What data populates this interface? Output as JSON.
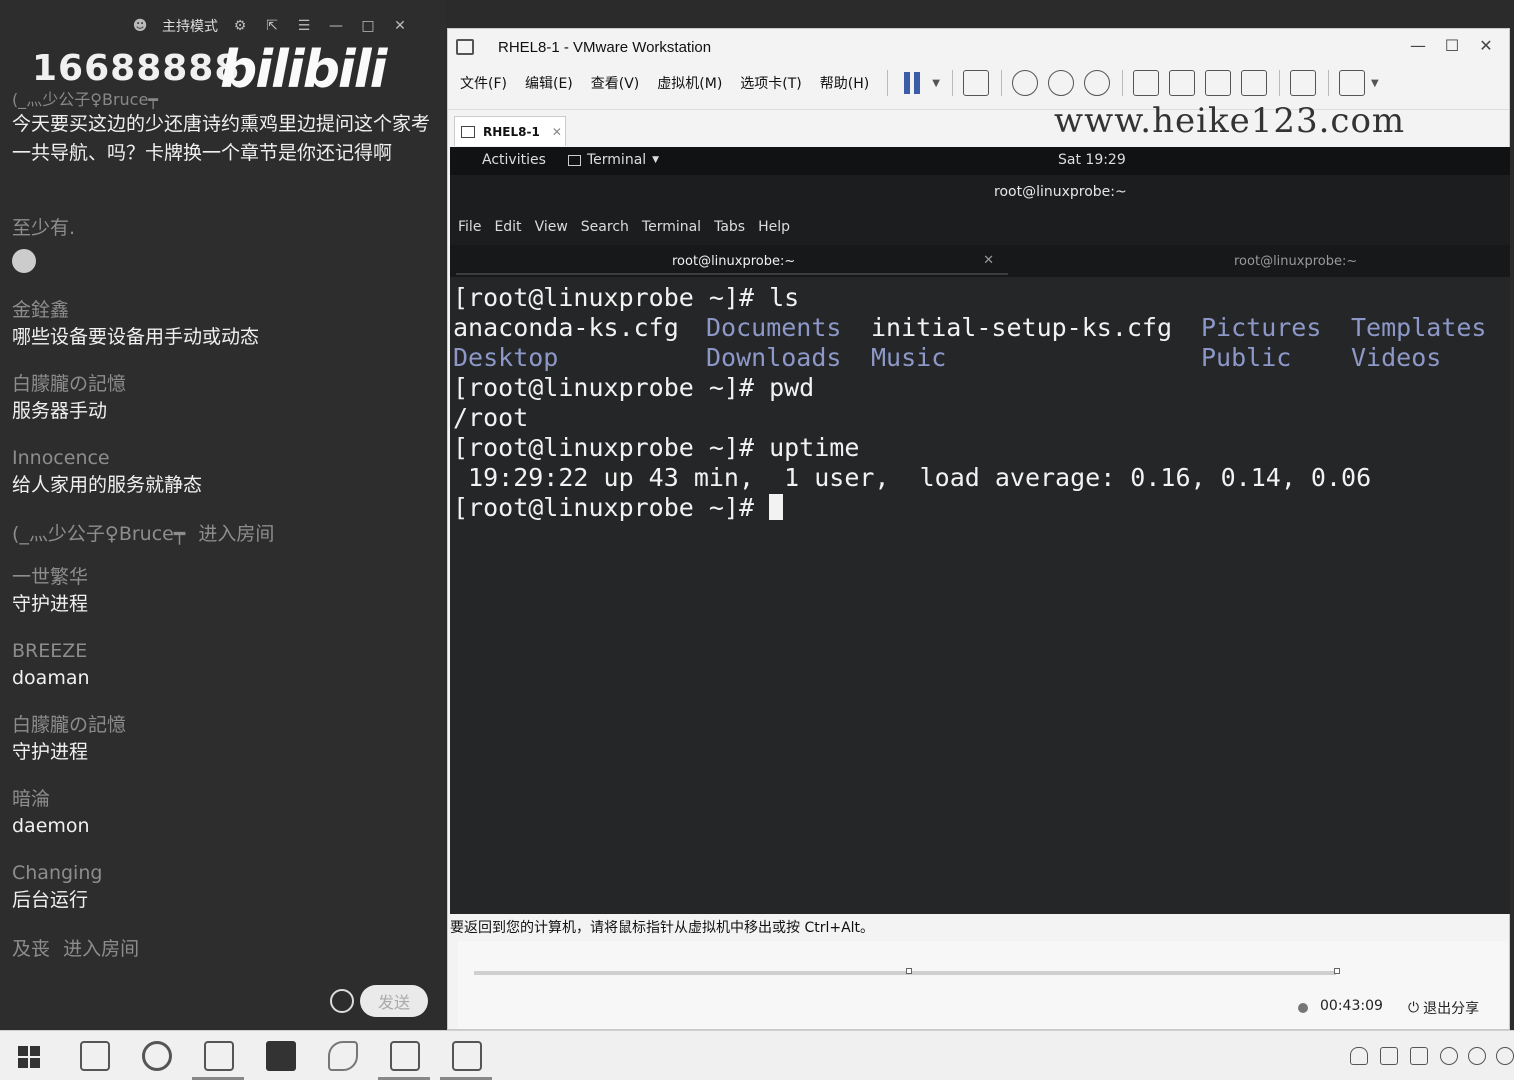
{
  "chat": {
    "topbar": {
      "host_mode": "主持模式"
    },
    "room_id": "16688888",
    "brand": "bilibili",
    "partial_line": "(_灬少公子♀Bruce┯",
    "messages": [
      {
        "name": "",
        "text": "今天要买这边的少还唐诗约熏鸡里边提问这个家考一共导航、吗？卡牌换一个章节是你还记得啊"
      },
      {
        "name": "至少有.",
        "text": ""
      },
      {
        "name": "金銓鑫",
        "text": "哪些设备要设备用手动或动态"
      },
      {
        "name": "白朦朧の記憶",
        "text": "服务器手动"
      },
      {
        "name": "Innocence",
        "text": "给人家用的服务就静态"
      },
      {
        "name": "(_灬少公子♀Bruce┯",
        "enter": "进入房间"
      },
      {
        "name": "一世繁华",
        "text": "守护进程"
      },
      {
        "name": "BREEZE",
        "text": "doaman"
      },
      {
        "name": "白朦朧の記憶",
        "text": "守护进程"
      },
      {
        "name": "暗淪",
        "text": "daemon"
      },
      {
        "name": "Changing",
        "text": "后台运行"
      },
      {
        "name": "及丧",
        "enter": "进入房间"
      }
    ],
    "send_label": "发送"
  },
  "vmware": {
    "title": "RHEL8-1 - VMware Workstation",
    "menu": [
      "文件(F)",
      "编辑(E)",
      "查看(V)",
      "虚拟机(M)",
      "选项卡(T)",
      "帮助(H)"
    ],
    "tab_label": "RHEL8-1",
    "watermark": "www.heike123.com",
    "status_text": "要返回到您的计算机，请将鼠标指针从虚拟机中移出或按 Ctrl+Alt。",
    "record_time": "00:43:09",
    "exit_share": "退出分享"
  },
  "guest": {
    "activities": "Activities",
    "app_menu": "Terminal",
    "clock": "Sat 19:29",
    "window_title": "root@linuxprobe:~",
    "menu": [
      "File",
      "Edit",
      "View",
      "Search",
      "Terminal",
      "Tabs",
      "Help"
    ],
    "tabs": [
      {
        "label": "root@linuxprobe:~",
        "active": true
      },
      {
        "label": "root@linuxprobe:~",
        "active": false
      }
    ],
    "terminal": {
      "cmd1": "[root@linuxprobe ~]# ls",
      "ls_row1": [
        "anaconda-ks.cfg",
        "Documents",
        "initial-setup-ks.cfg",
        "Pictures",
        "Templates"
      ],
      "ls_row2": [
        "Desktop",
        "Downloads",
        "Music",
        "Public",
        "Videos"
      ],
      "cmd2": "[root@linuxprobe ~]# pwd",
      "out2": "/root",
      "cmd3": "[root@linuxprobe ~]# uptime",
      "out3": " 19:29:22 up 43 min,  1 user,  load average: 0.16, 0.14, 0.06",
      "prompt": "[root@linuxprobe ~]# "
    }
  }
}
